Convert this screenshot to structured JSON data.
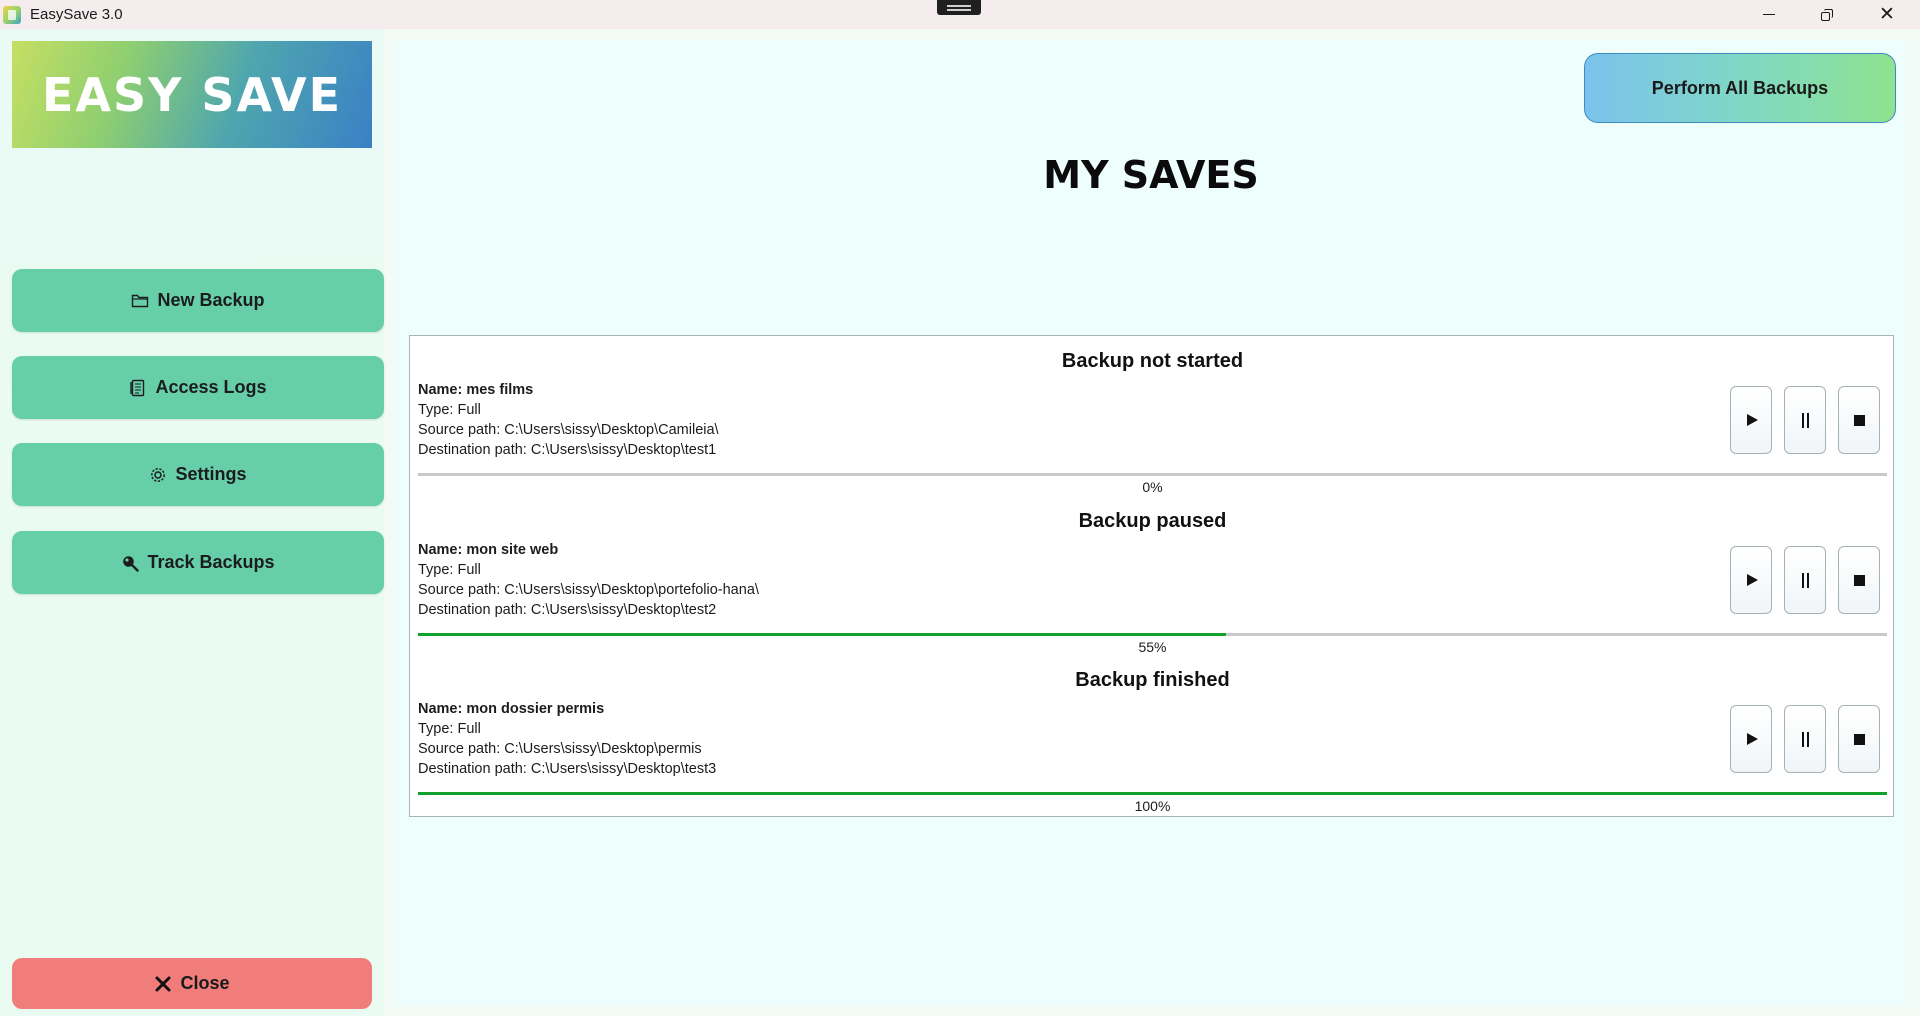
{
  "window": {
    "title": "EasySave 3.0"
  },
  "sidebar": {
    "logo_text": "EASY SAVE",
    "items": [
      {
        "label": "New Backup",
        "icon": "folder-icon"
      },
      {
        "label": "Access Logs",
        "icon": "document-icon"
      },
      {
        "label": "Settings",
        "icon": "gear-icon"
      },
      {
        "label": "Track Backups",
        "icon": "magnifier-icon"
      }
    ],
    "close_label": "Close"
  },
  "main": {
    "perform_all_label": "Perform All Backups",
    "page_title": "MY SAVES",
    "backups": [
      {
        "status": "Backup not started",
        "name": "Name: mes films",
        "type": "Type: Full",
        "source": "Source path: C:\\Users\\sissy\\Desktop\\Camileia\\",
        "destination": "Destination path: C:\\Users\\sissy\\Desktop\\test1",
        "progress": 0,
        "progress_label": "0%"
      },
      {
        "status": "Backup paused",
        "name": "Name: mon site web",
        "type": "Type: Full",
        "source": "Source path: C:\\Users\\sissy\\Desktop\\portefolio-hana\\",
        "destination": "Destination path: C:\\Users\\sissy\\Desktop\\test2",
        "progress": 55,
        "progress_label": "55%"
      },
      {
        "status": "Backup finished",
        "name": "Name: mon dossier permis",
        "type": "Type: Full",
        "source": "Source path: C:\\Users\\sissy\\Desktop\\permis",
        "destination": "Destination path: C:\\Users\\sissy\\Desktop\\test3",
        "progress": 100,
        "progress_label": "100%"
      }
    ]
  },
  "colors": {
    "nav_button": "#66cfaa",
    "close_button": "#f07d7a",
    "progress_fill": "#12a12a",
    "progress_track": "#c9c9c9",
    "main_background": "#edfefc"
  }
}
